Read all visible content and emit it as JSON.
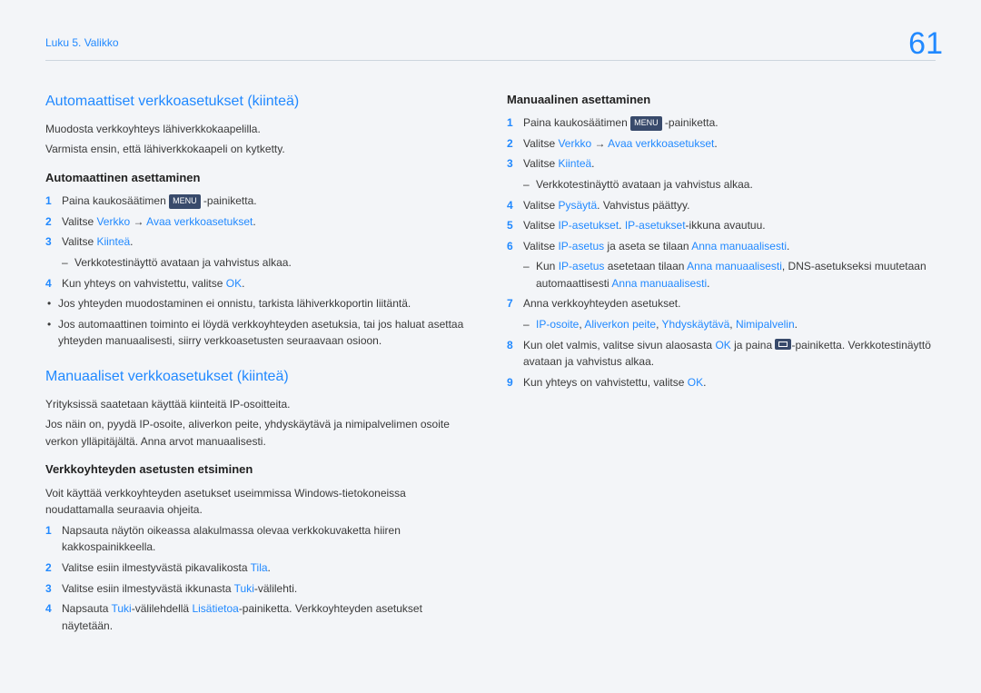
{
  "page_number": "61",
  "breadcrumb": "Luku 5. Valikko",
  "sec1": {
    "title": "Automaattiset verkkoasetukset (kiinteä)",
    "p1": "Muodosta verkkoyhteys lähiverkkokaapelilla.",
    "p2": "Varmista ensin, että lähiverkkokaapeli on kytketty.",
    "sub": "Automaattinen asettaminen",
    "li1a": "Paina kaukosäätimen ",
    "li1tag": "MENU",
    "li1b": " -painiketta.",
    "li2a": "Valitse ",
    "li2b": "Verkko",
    "li2c": " → ",
    "li2d": "Avaa verkkoasetukset",
    "li2e": ".",
    "li3a": "Valitse ",
    "li3b": "Kiinteä",
    "li3c": ".",
    "li3d": "Verkkotestinäyttö avataan ja vahvistus alkaa.",
    "li4a": "Kun yhteys on vahvistettu, valitse ",
    "li4b": "OK",
    "li4c": ".",
    "b1": "Jos yhteyden muodostaminen ei onnistu, tarkista lähiverkkoportin liitäntä.",
    "b2": "Jos automaattinen toiminto ei löydä verkkoyhteyden asetuksia, tai jos haluat asettaa yhteyden manuaalisesti, siirry verkkoasetusten seuraavaan osioon."
  },
  "sec2": {
    "title": "Manuaaliset verkkoasetukset (kiinteä)",
    "p1": "Yrityksissä saatetaan käyttää kiinteitä IP-osoitteita.",
    "p2": "Jos näin on, pyydä IP-osoite, aliverkon peite, yhdyskäytävä ja nimipalvelimen osoite verkon ylläpitäjältä. Anna arvot manuaalisesti.",
    "sub1": "Verkkoyhteyden asetusten etsiminen",
    "p3": "Voit käyttää verkkoyhteyden asetukset useimmissa Windows-tietokoneissa noudattamalla seuraavia ohjeita.",
    "f1": "Napsauta näytön oikeassa alakulmassa olevaa verkkokuvaketta hiiren kakkospainikkeella.",
    "f2a": "Valitse esiin ilmestyvästä pikavalikosta ",
    "f2b": "Tila",
    "f2c": ".",
    "f3a": "Valitse esiin ilmestyvästä ikkunasta ",
    "f3b": "Tuki",
    "f3c": "-välilehti.",
    "f4a": "Napsauta ",
    "f4b": "Tuki",
    "f4c": "-välilehdellä ",
    "f4d": "Lisätietoa",
    "f4e": "-painiketta. Verkkoyhteyden asetukset näytetään.",
    "sub2": "Manuaalinen asettaminen",
    "m1a": "Paina kaukosäätimen ",
    "m1tag": "MENU",
    "m1b": " -painiketta.",
    "m2a": "Valitse ",
    "m2b": "Verkko",
    "m2c": " → ",
    "m2d": "Avaa verkkoasetukset",
    "m2e": ".",
    "m3a": "Valitse ",
    "m3b": "Kiinteä",
    "m3c": ".",
    "m3d": "Verkkotestinäyttö avataan ja vahvistus alkaa.",
    "m4a": "Valitse ",
    "m4b": "Pysäytä",
    "m4c": ". Vahvistus päättyy.",
    "m5a": "Valitse ",
    "m5b": "IP-asetukset",
    "m5c": ". ",
    "m5d": "IP-asetukset",
    "m5e": "-ikkuna avautuu.",
    "m6a": "Valitse ",
    "m6b": "IP-asetus",
    "m6c": " ja aseta se tilaan ",
    "m6d": "Anna manuaalisesti",
    "m6e": ".",
    "m6f_a": "Kun ",
    "m6f_b": "IP-asetus",
    "m6f_c": " asetetaan tilaan ",
    "m6f_d": "Anna manuaalisesti",
    "m6f_e": ", DNS-asetukseksi muutetaan automaattisesti ",
    "m6f_f": "Anna manuaalisesti",
    "m6f_g": ".",
    "m7": "Anna verkkoyhteyden asetukset.",
    "m7_a": "IP-osoite",
    "m7_b": "Aliverkon peite",
    "m7_c": "Yhdyskäytävä",
    "m7_d": "Nimipalvelin",
    "m7_sep": ", ",
    "m7_end": ".",
    "m8a": "Kun olet valmis, valitse sivun alaosasta ",
    "m8b": "OK",
    "m8c": " ja paina ",
    "m8d": "-painiketta. Verkkotestinäyttö avataan ja vahvistus alkaa.",
    "m9a": "Kun yhteys on vahvistettu, valitse ",
    "m9b": "OK",
    "m9c": "."
  }
}
